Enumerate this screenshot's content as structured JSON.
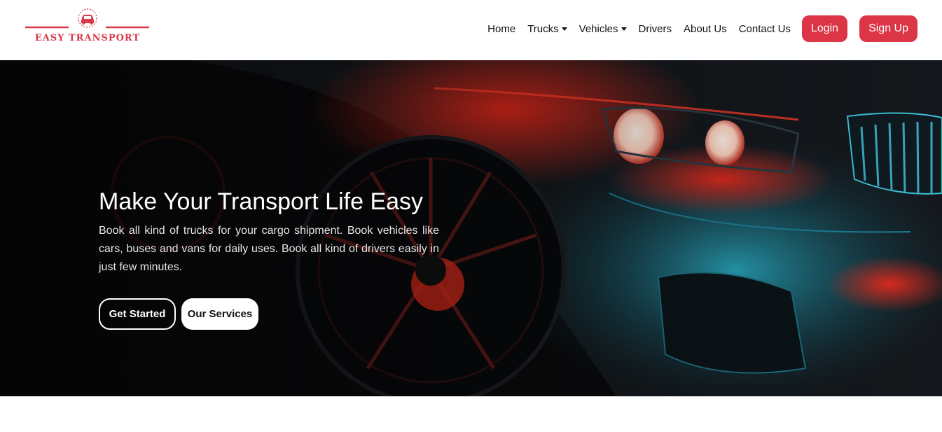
{
  "brand": {
    "name": "EASY TRANSPORT",
    "color": "#d9394a",
    "icon": "car-icon"
  },
  "nav": {
    "items": [
      {
        "label": "Home"
      },
      {
        "label": "Trucks",
        "dropdown": true
      },
      {
        "label": "Vehicles",
        "dropdown": true
      },
      {
        "label": "Drivers"
      },
      {
        "label": "About Us"
      },
      {
        "label": "Contact Us"
      }
    ],
    "login_label": "Login",
    "signup_label": "Sign Up",
    "button_color": "#dc3545"
  },
  "hero": {
    "title": "Make Your Transport Life Easy",
    "description": "Book all kind of trucks for your cargo shipment. Book vehicles like cars, buses and vans for daily uses. Book all kind of drivers easily in just few minutes.",
    "primary_button": "Get Started",
    "secondary_button": "Our Services",
    "background": "dark sports car with red and teal lighting"
  }
}
